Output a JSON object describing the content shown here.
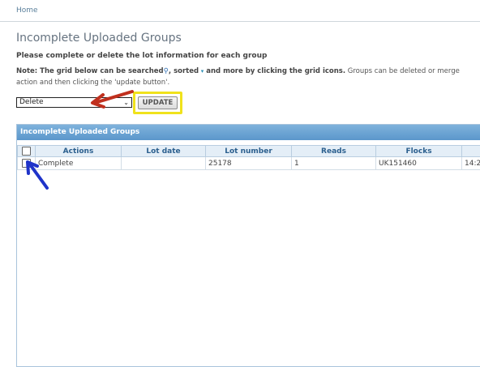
{
  "breadcrumb": {
    "home": "Home"
  },
  "page": {
    "title": "Incomplete Uploaded Groups",
    "instruction": "Please complete or delete the lot information for each group",
    "note_bold_1": "Note: The grid below can be searched",
    "note_search_glyph": "⚲",
    "note_bold_2": ", sorted",
    "note_sort_glyph": "▾",
    "note_bold_3": " and more by clicking the grid icons.",
    "note_rest_1": " Groups can be deleted or merge",
    "note_rest_2": "action and then clicking the 'update button'."
  },
  "toolbar": {
    "action_select_value": "Delete",
    "update_label": "UPDATE"
  },
  "grid": {
    "caption": "Incomplete Uploaded Groups",
    "columns": [
      "Actions",
      "Lot date",
      "Lot number",
      "Reads",
      "Flocks",
      ""
    ],
    "rows": [
      {
        "actions": "Complete",
        "lot_date": "",
        "lot_number": "25178",
        "reads": "1",
        "flocks": "UK151460",
        "time": "14:2"
      }
    ]
  },
  "annotations": {
    "red_arrow_color": "#c0301e",
    "blue_arrow_color": "#1f33c9",
    "highlight_color": "#f0e21c"
  }
}
